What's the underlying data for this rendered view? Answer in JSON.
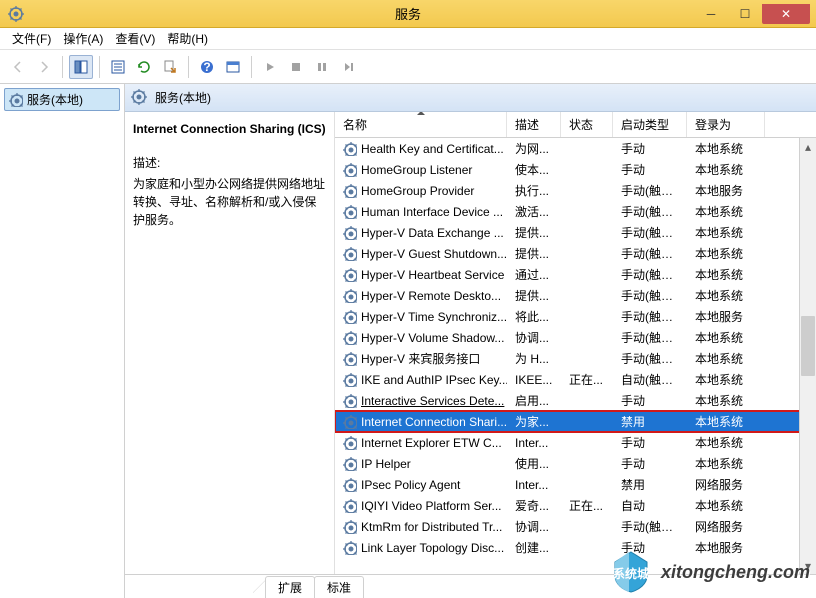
{
  "window": {
    "title": "服务"
  },
  "menu": {
    "file": "文件(F)",
    "action": "操作(A)",
    "view": "查看(V)",
    "help": "帮助(H)"
  },
  "tree": {
    "root": "服务(本地)"
  },
  "pane": {
    "header": "服务(本地)"
  },
  "detail": {
    "name": "Internet Connection Sharing (ICS)",
    "desc_label": "描述:",
    "desc": "为家庭和小型办公网络提供网络地址转换、寻址、名称解析和/或入侵保护服务。"
  },
  "columns": {
    "name": "名称",
    "desc": "描述",
    "status": "状态",
    "start": "启动类型",
    "logon": "登录为"
  },
  "rows": [
    {
      "name": "Health Key and Certificat...",
      "desc": "为网...",
      "status": "",
      "start": "手动",
      "logon": "本地系统"
    },
    {
      "name": "HomeGroup Listener",
      "desc": "使本...",
      "status": "",
      "start": "手动",
      "logon": "本地系统"
    },
    {
      "name": "HomeGroup Provider",
      "desc": "执行...",
      "status": "",
      "start": "手动(触发...",
      "logon": "本地服务"
    },
    {
      "name": "Human Interface Device ...",
      "desc": "激活...",
      "status": "",
      "start": "手动(触发...",
      "logon": "本地系统"
    },
    {
      "name": "Hyper-V Data Exchange ...",
      "desc": "提供...",
      "status": "",
      "start": "手动(触发...",
      "logon": "本地系统"
    },
    {
      "name": "Hyper-V Guest Shutdown...",
      "desc": "提供...",
      "status": "",
      "start": "手动(触发...",
      "logon": "本地系统"
    },
    {
      "name": "Hyper-V Heartbeat Service",
      "desc": "通过...",
      "status": "",
      "start": "手动(触发...",
      "logon": "本地系统"
    },
    {
      "name": "Hyper-V Remote Deskto...",
      "desc": "提供...",
      "status": "",
      "start": "手动(触发...",
      "logon": "本地系统"
    },
    {
      "name": "Hyper-V Time Synchroniz...",
      "desc": "将此...",
      "status": "",
      "start": "手动(触发...",
      "logon": "本地服务"
    },
    {
      "name": "Hyper-V Volume Shadow...",
      "desc": "协调...",
      "status": "",
      "start": "手动(触发...",
      "logon": "本地系统"
    },
    {
      "name": "Hyper-V 来宾服务接口",
      "desc": "为 H...",
      "status": "",
      "start": "手动(触发...",
      "logon": "本地系统"
    },
    {
      "name": "IKE and AuthIP IPsec Key...",
      "desc": "IKEE...",
      "status": "正在...",
      "start": "自动(触发...",
      "logon": "本地系统"
    },
    {
      "name": "Interactive Services Dete...",
      "desc": "启用...",
      "status": "",
      "start": "手动",
      "logon": "本地系统",
      "underline": true
    },
    {
      "name": "Internet Connection Shari...",
      "desc": "为家...",
      "status": "",
      "start": "禁用",
      "logon": "本地系统",
      "selected": true,
      "highlight": true
    },
    {
      "name": "Internet Explorer ETW C...",
      "desc": "Inter...",
      "status": "",
      "start": "手动",
      "logon": "本地系统"
    },
    {
      "name": "IP Helper",
      "desc": "使用...",
      "status": "",
      "start": "手动",
      "logon": "本地系统"
    },
    {
      "name": "IPsec Policy Agent",
      "desc": "Inter...",
      "status": "",
      "start": "禁用",
      "logon": "网络服务"
    },
    {
      "name": "IQIYI Video Platform Ser...",
      "desc": "爱奇...",
      "status": "正在...",
      "start": "自动",
      "logon": "本地系统"
    },
    {
      "name": "KtmRm for Distributed Tr...",
      "desc": "协调...",
      "status": "",
      "start": "手动(触发...",
      "logon": "网络服务"
    },
    {
      "name": "Link Layer Topology Disc...",
      "desc": "创建...",
      "status": "",
      "start": "手动",
      "logon": "本地服务"
    }
  ],
  "tabs": {
    "extended": "扩展",
    "standard": "标准"
  },
  "watermark": {
    "text": "xitongcheng.com",
    "brand": "系统城"
  }
}
